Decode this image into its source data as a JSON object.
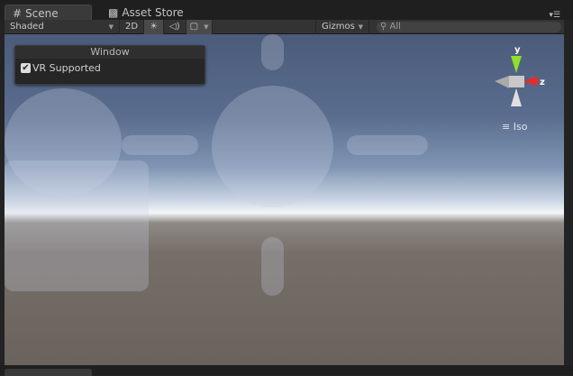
{
  "tabs": [
    {
      "label": "Scene",
      "icon": "hash-icon",
      "active": true
    },
    {
      "label": "Asset Store",
      "icon": "bag-icon",
      "active": false
    }
  ],
  "toolbar": {
    "draw_mode": "Shaded",
    "mode_2d": "2D",
    "gizmos": "Gizmos",
    "search_placeholder": "All"
  },
  "overlay_window": {
    "title": "Window",
    "checkbox_label": "VR Supported",
    "checked": true
  },
  "gizmo": {
    "y_label": "y",
    "z_label": "z",
    "projection": "Iso"
  },
  "colors": {
    "y_axis": "#8ee02a",
    "x_axis": "#d8322a",
    "z_axis": "#3a6ad8"
  }
}
